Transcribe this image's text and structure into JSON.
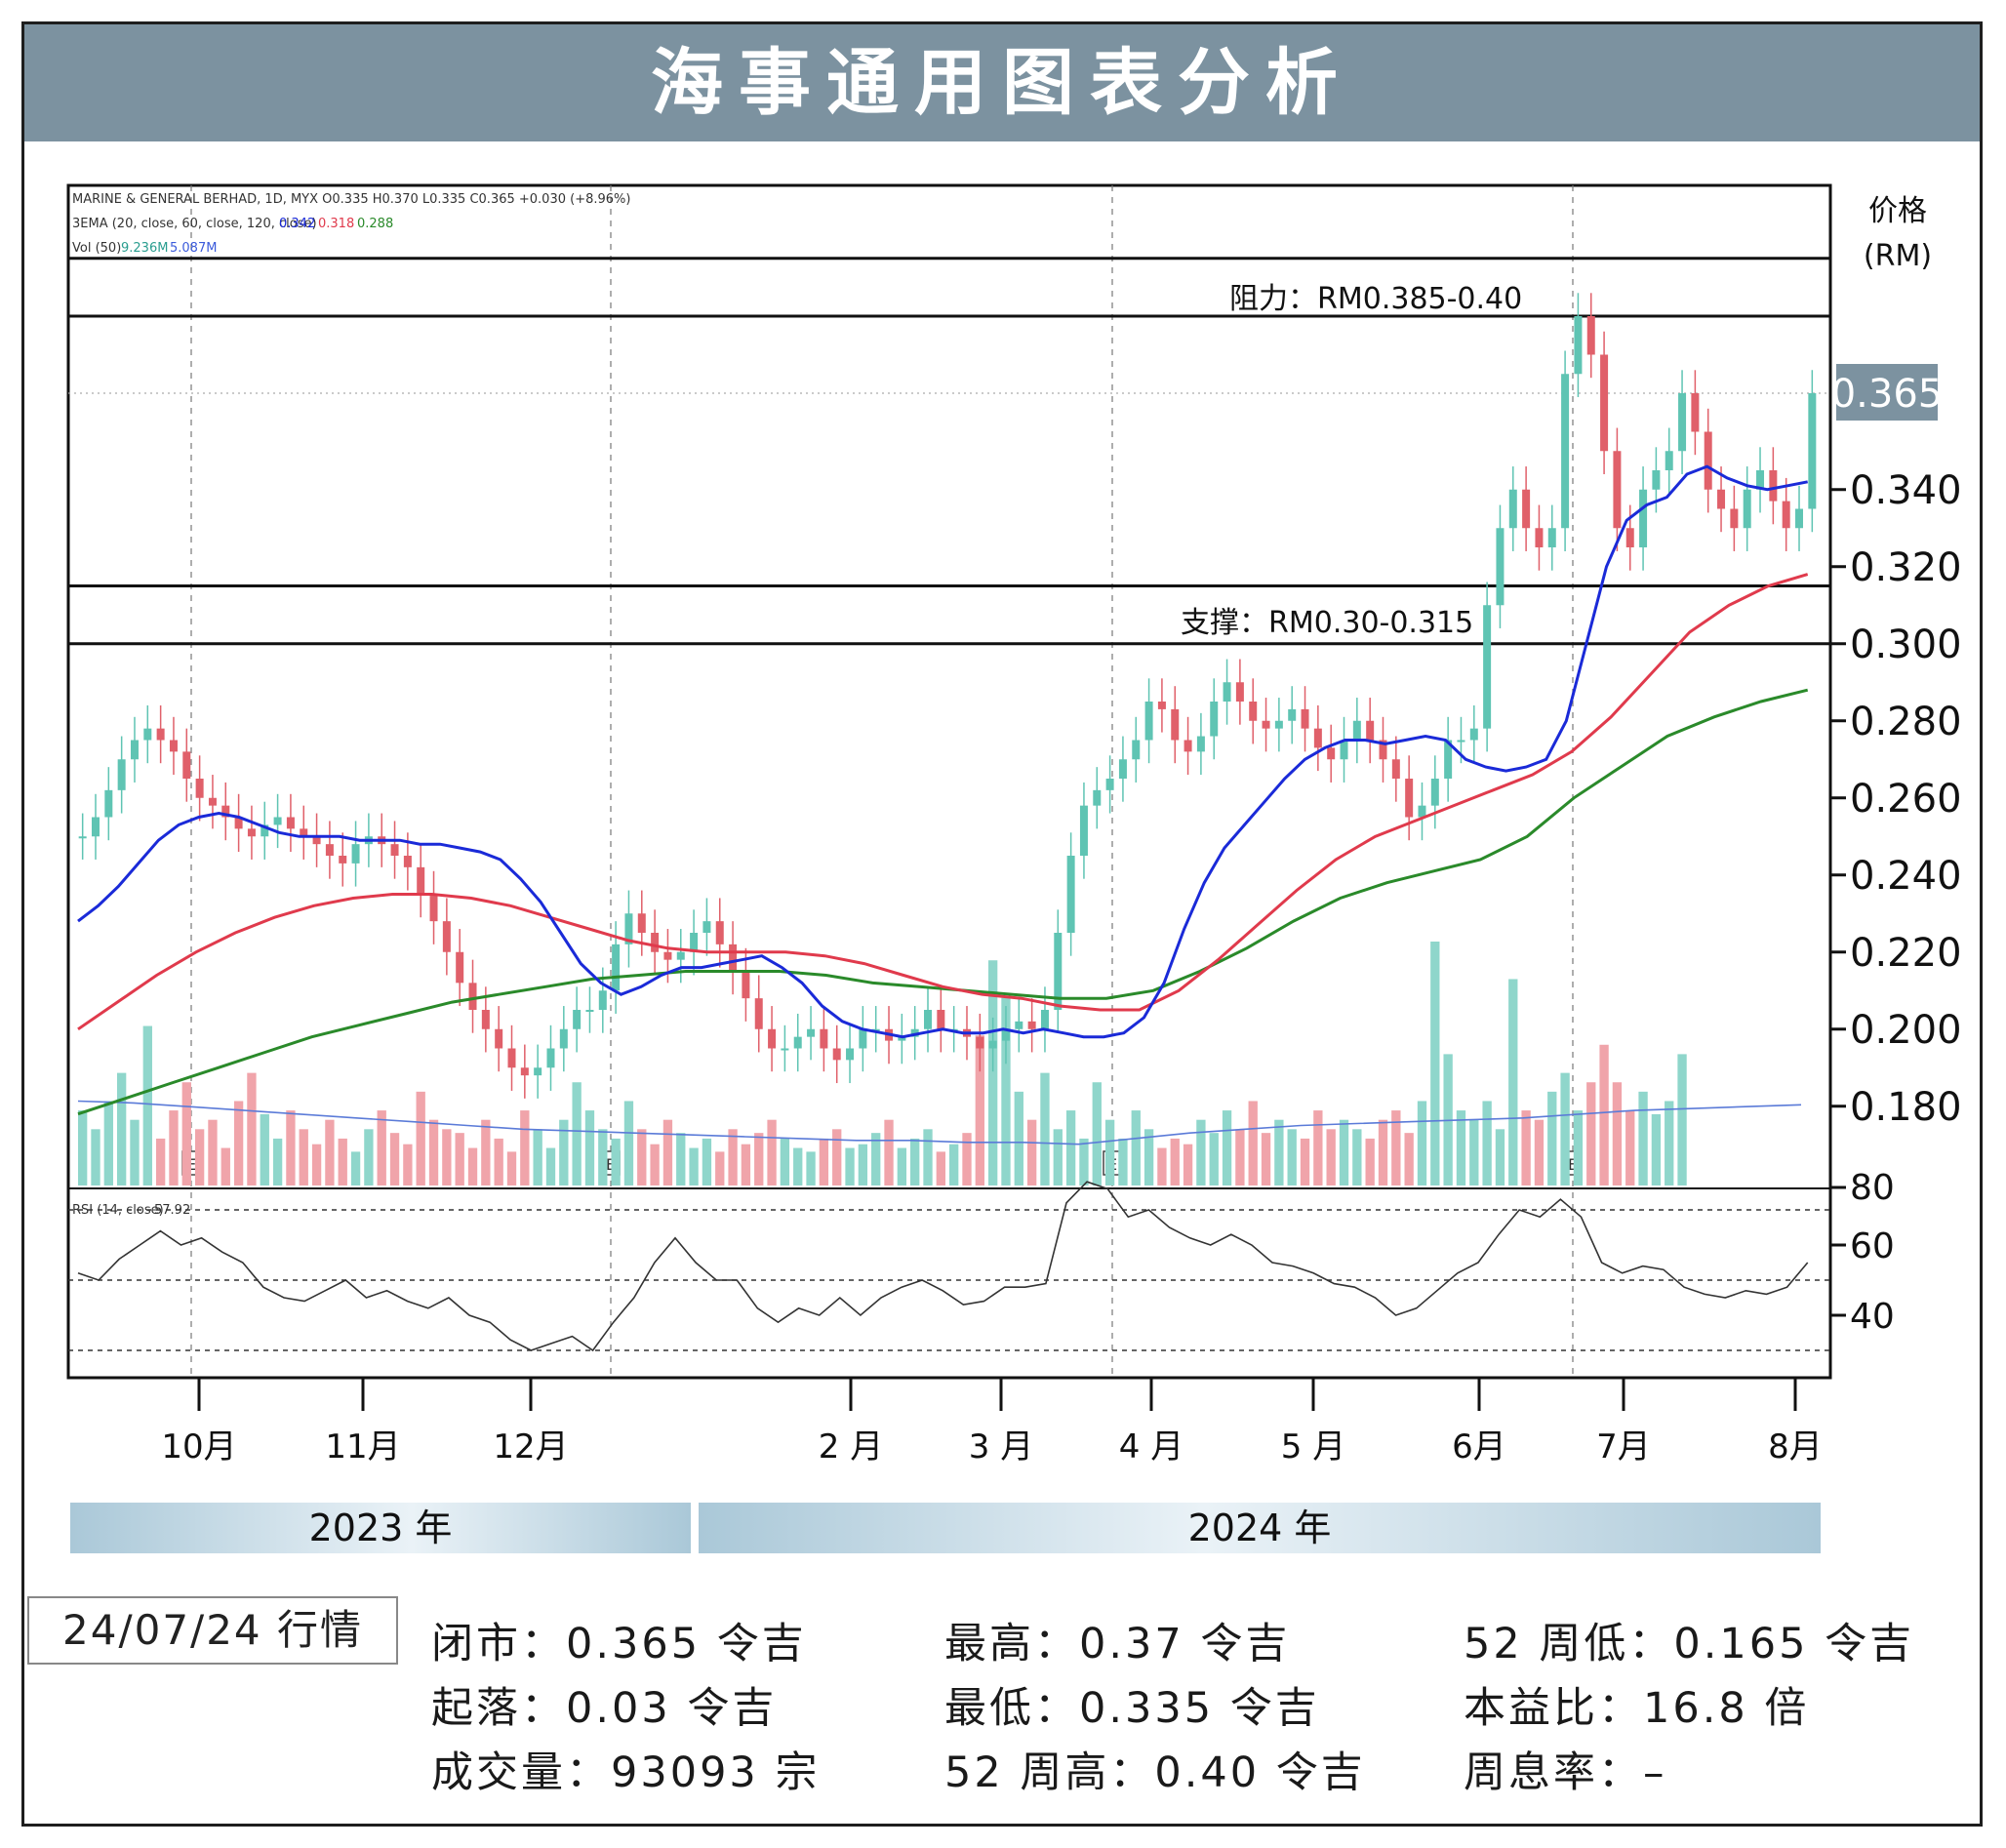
{
  "title": "海事通用图表分析",
  "chart_data": {
    "type": "candlestick",
    "header_lines": [
      "MARINE & GENERAL BERHAD, 1D, MYX  O0.335  H0.370  L0.335  C0.365  +0.030 (+8.96%)",
      "3EMA (20, close, 60, close, 120, close)",
      "Vol (50)"
    ],
    "ema_legend_values": [
      "0.342",
      "0.318",
      "0.288"
    ],
    "vol_legend_values": [
      "9.236M",
      "5.087M"
    ],
    "ylabel": "价格\n(RM)",
    "y_ticks": [
      "0.340",
      "0.320",
      "0.300",
      "0.280",
      "0.260",
      "0.240",
      "0.220",
      "0.200",
      "0.180"
    ],
    "ylim": [
      0.165,
      0.405
    ],
    "last_price_label": "0.365",
    "resistance_label": "阻力：RM0.385-0.40",
    "resistance": [
      0.385,
      0.4
    ],
    "support_label": "支撑：RM0.30-0.315",
    "support": [
      0.3,
      0.315
    ],
    "x_ticks": [
      "10月",
      "11月",
      "12月",
      "2 月",
      "3 月",
      "4 月",
      "5 月",
      "6月",
      "7月",
      "8月"
    ],
    "years": [
      "2023 年",
      "2024 年"
    ],
    "earnings_marker": "E",
    "volume_tick": "80",
    "rsi_label": "RSI (14, close)",
    "rsi_value": "57.92",
    "rsi_ticks": [
      "60",
      "40"
    ],
    "rsi_bands": [
      70,
      50,
      30
    ],
    "close_series": [
      0.25,
      0.255,
      0.262,
      0.27,
      0.275,
      0.278,
      0.275,
      0.272,
      0.265,
      0.26,
      0.258,
      0.255,
      0.252,
      0.25,
      0.253,
      0.255,
      0.252,
      0.25,
      0.248,
      0.245,
      0.243,
      0.248,
      0.25,
      0.248,
      0.245,
      0.242,
      0.235,
      0.228,
      0.22,
      0.212,
      0.205,
      0.2,
      0.195,
      0.19,
      0.188,
      0.19,
      0.195,
      0.2,
      0.205,
      0.205,
      0.21,
      0.222,
      0.23,
      0.225,
      0.22,
      0.218,
      0.22,
      0.225,
      0.228,
      0.222,
      0.215,
      0.208,
      0.2,
      0.195,
      0.195,
      0.198,
      0.2,
      0.195,
      0.192,
      0.195,
      0.2,
      0.2,
      0.197,
      0.198,
      0.2,
      0.205,
      0.2,
      0.2,
      0.198,
      0.195,
      0.197,
      0.2,
      0.202,
      0.2,
      0.205,
      0.225,
      0.245,
      0.258,
      0.262,
      0.265,
      0.27,
      0.275,
      0.285,
      0.283,
      0.275,
      0.272,
      0.276,
      0.285,
      0.29,
      0.285,
      0.28,
      0.278,
      0.28,
      0.283,
      0.278,
      0.273,
      0.27,
      0.275,
      0.28,
      0.275,
      0.27,
      0.265,
      0.255,
      0.258,
      0.265,
      0.275,
      0.275,
      0.278,
      0.31,
      0.33,
      0.34,
      0.33,
      0.325,
      0.33,
      0.37,
      0.385,
      0.375,
      0.35,
      0.33,
      0.325,
      0.34,
      0.345,
      0.35,
      0.365,
      0.355,
      0.34,
      0.335,
      0.33,
      0.34,
      0.345,
      0.337,
      0.33,
      0.335,
      0.365
    ],
    "ema20": [
      0.228,
      0.232,
      0.237,
      0.243,
      0.249,
      0.253,
      0.255,
      0.256,
      0.255,
      0.253,
      0.251,
      0.25,
      0.25,
      0.25,
      0.249,
      0.249,
      0.249,
      0.248,
      0.248,
      0.247,
      0.246,
      0.244,
      0.239,
      0.233,
      0.225,
      0.217,
      0.212,
      0.209,
      0.211,
      0.214,
      0.216,
      0.216,
      0.217,
      0.218,
      0.219,
      0.216,
      0.212,
      0.206,
      0.202,
      0.2,
      0.199,
      0.198,
      0.199,
      0.2,
      0.199,
      0.199,
      0.2,
      0.199,
      0.2,
      0.199,
      0.198,
      0.198,
      0.199,
      0.203,
      0.212,
      0.226,
      0.238,
      0.247,
      0.253,
      0.259,
      0.265,
      0.27,
      0.273,
      0.275,
      0.275,
      0.274,
      0.275,
      0.276,
      0.275,
      0.27,
      0.268,
      0.267,
      0.268,
      0.27,
      0.28,
      0.3,
      0.32,
      0.332,
      0.336,
      0.338,
      0.344,
      0.346,
      0.343,
      0.341,
      0.34,
      0.341,
      0.342
    ],
    "ema60": [
      0.2,
      0.207,
      0.214,
      0.22,
      0.225,
      0.229,
      0.232,
      0.234,
      0.235,
      0.235,
      0.234,
      0.232,
      0.229,
      0.226,
      0.223,
      0.221,
      0.22,
      0.22,
      0.22,
      0.219,
      0.217,
      0.214,
      0.211,
      0.209,
      0.208,
      0.206,
      0.205,
      0.205,
      0.21,
      0.218,
      0.227,
      0.236,
      0.244,
      0.25,
      0.254,
      0.258,
      0.262,
      0.266,
      0.272,
      0.281,
      0.292,
      0.303,
      0.31,
      0.315,
      0.318
    ],
    "ema120": [
      0.178,
      0.182,
      0.186,
      0.19,
      0.194,
      0.198,
      0.201,
      0.204,
      0.207,
      0.209,
      0.211,
      0.213,
      0.214,
      0.215,
      0.215,
      0.215,
      0.214,
      0.212,
      0.211,
      0.21,
      0.209,
      0.208,
      0.208,
      0.21,
      0.215,
      0.221,
      0.228,
      0.234,
      0.238,
      0.241,
      0.244,
      0.25,
      0.26,
      0.268,
      0.276,
      0.281,
      0.285,
      0.288
    ],
    "volume": [
      40,
      30,
      45,
      60,
      35,
      85,
      25,
      40,
      55,
      30,
      35,
      20,
      45,
      60,
      38,
      25,
      40,
      30,
      22,
      35,
      25,
      18,
      30,
      40,
      28,
      22,
      50,
      35,
      30,
      28,
      20,
      35,
      25,
      18,
      40,
      30,
      20,
      35,
      55,
      40,
      30,
      25,
      45,
      30,
      22,
      35,
      28,
      20,
      25,
      18,
      30,
      22,
      28,
      35,
      25,
      20,
      18,
      25,
      30,
      20,
      22,
      28,
      35,
      20,
      25,
      30,
      18,
      22,
      28,
      80,
      120,
      100,
      50,
      35,
      60,
      30,
      40,
      25,
      55,
      35,
      25,
      40,
      30,
      20,
      25,
      22,
      35,
      28,
      40,
      30,
      45,
      28,
      35,
      30,
      25,
      40,
      30,
      35,
      30,
      25,
      35,
      40,
      28,
      45,
      130,
      70,
      40,
      35,
      45,
      30,
      110,
      40,
      35,
      50,
      60,
      40,
      55,
      75,
      55,
      40,
      50,
      38,
      45,
      70
    ],
    "volume_avg": [
      45,
      44,
      42,
      40,
      38,
      36,
      34,
      32,
      30,
      29,
      28,
      27,
      26,
      25,
      24,
      24,
      23,
      23,
      22,
      25,
      28,
      30,
      32,
      33,
      34,
      35,
      36,
      38,
      40,
      41,
      42,
      43
    ],
    "rsi": [
      52,
      50,
      56,
      60,
      64,
      60,
      62,
      58,
      55,
      48,
      45,
      44,
      47,
      50,
      45,
      47,
      44,
      42,
      45,
      40,
      38,
      33,
      30,
      32,
      34,
      30,
      38,
      45,
      55,
      62,
      55,
      50,
      50,
      42,
      38,
      42,
      40,
      45,
      40,
      45,
      48,
      50,
      47,
      43,
      44,
      48,
      48,
      49,
      72,
      78,
      76,
      68,
      70,
      65,
      62,
      60,
      63,
      60,
      55,
      54,
      52,
      49,
      48,
      45,
      40,
      42,
      47,
      52,
      55,
      63,
      70,
      68,
      73,
      68,
      55,
      52,
      54,
      53,
      48,
      46,
      45,
      47,
      46,
      48,
      55
    ]
  },
  "stats": {
    "date": "24/07/24 行情",
    "close": "闭市：0.365 令吉",
    "change": "起落：0.03 令吉",
    "volume": "成交量：93093 宗",
    "high": "最高：0.37 令吉",
    "low": "最低：0.335 令吉",
    "high52": "52 周高：0.40 令吉",
    "low52": "52 周低：0.165 令吉",
    "pe": "本益比：16.8 倍",
    "yield": "周息率：–"
  },
  "colors": {
    "up": "#5fc4b3",
    "down": "#e0606a",
    "ema20": "#1a2ad8",
    "ema60": "#e03a4c",
    "ema120": "#2a8a2a",
    "header": "#7c92a0"
  }
}
